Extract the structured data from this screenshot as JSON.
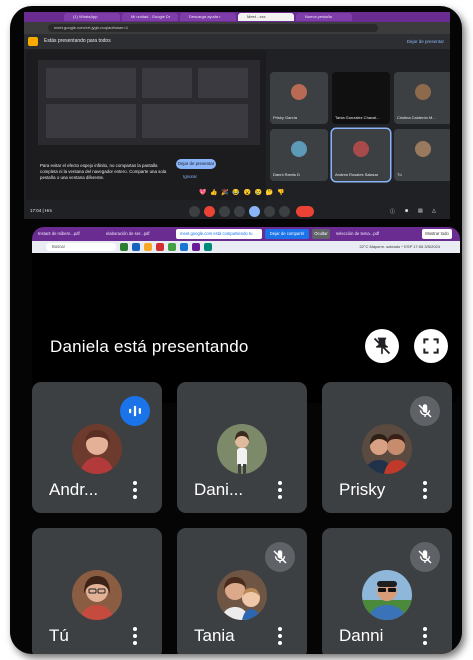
{
  "browser": {
    "tabs": [
      "(1) WhatsApp",
      "Mi unidad - Google Dr",
      "Descarga ayuda r",
      "Meet - xxx",
      "Nueva pestaña"
    ],
    "address": "meet.google.com/xrf-jygb-noq/authuser=1"
  },
  "meet_mini": {
    "top_label": "Estás presentando para todos",
    "stop_label": "Dejar de presentar",
    "warning_text": "Para evitar el efecto espejo infinito, no compartas la pantalla completa ni la ventana del navegador entero. Comparte una sola pestaña o una ventana diferente.",
    "warning_button": "Dejar de presentar",
    "warning_ignore": "Ignorar",
    "participants": [
      {
        "name": "Prisky García"
      },
      {
        "name": "Tania Gonzalez Chaval..."
      },
      {
        "name": "Cristina Calderón M..."
      },
      {
        "name": "Danni Ramis D"
      },
      {
        "name": "Andrea Rosales Salazar"
      },
      {
        "name": "Tú"
      }
    ],
    "emoji_row": "💖 👍 🎉 😂 😮 😢 🤔 👎",
    "time": "17:04 | Hrs"
  },
  "shared_screen": {
    "tabs": [
      "Instant de mibern...pdf",
      "elaboración de ser...pdf",
      "selección de tema...pdf"
    ],
    "share_hint": "meet.google.com está compartiendo tu pantalla",
    "stop_share": "Dejar de compartir",
    "hide": "Ocultar",
    "close_all": "Mostrar todo",
    "taskbar_search": "Buscar",
    "tray_text": "22°C Mayorm. soleado  ^  ESP  17:06  3/5/2024",
    "presenting_text": "Daniela está presentando"
  },
  "tiles": [
    {
      "name": "Andr...",
      "status": "speaking"
    },
    {
      "name": "Dani...",
      "status": "none"
    },
    {
      "name": "Prisky",
      "status": "muted"
    },
    {
      "name": "Tú",
      "status": "none"
    },
    {
      "name": "Tania",
      "status": "muted"
    },
    {
      "name": "Danni",
      "status": "muted"
    }
  ],
  "icons": {
    "pin_off": "pin-off-icon",
    "fullscreen": "fullscreen-icon",
    "mic_off": "mic-off-icon",
    "speaking": "audio-wave-icon",
    "more": "more-vert-icon"
  },
  "colors": {
    "tile_bg": "#3c4043",
    "page_bg": "#050505",
    "speaking_badge": "#1a73e8",
    "muted_badge": "#5f6368",
    "browser_purple": "#6a2c91"
  }
}
